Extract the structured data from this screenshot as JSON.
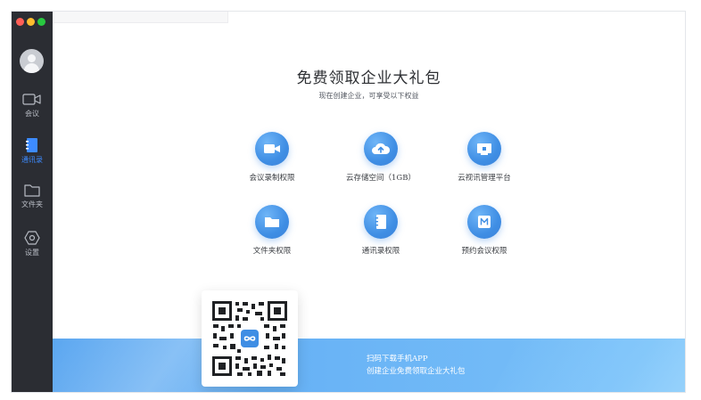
{
  "window": {
    "controls": [
      "close",
      "minimize",
      "zoom"
    ]
  },
  "sidebar": {
    "avatar_icon": "user-avatar-icon",
    "items": [
      {
        "label": "会议",
        "icon": "video-camera-icon",
        "active": false
      },
      {
        "label": "通讯录",
        "icon": "contacts-book-icon",
        "active": true
      },
      {
        "label": "文件夹",
        "icon": "folder-icon",
        "active": false
      },
      {
        "label": "设置",
        "icon": "settings-hexagon-icon",
        "active": false
      }
    ]
  },
  "main": {
    "title": "免费领取企业大礼包",
    "subtitle": "现在创建企业，可享受以下权益",
    "features": [
      {
        "label": "会议录制权限",
        "icon": "video-record-icon"
      },
      {
        "label": "云存储空间（1GB）",
        "icon": "cloud-upload-icon"
      },
      {
        "label": "云视讯管理平台",
        "icon": "monitor-icon"
      },
      {
        "label": "文件夹权限",
        "icon": "folder-icon"
      },
      {
        "label": "通讯录权限",
        "icon": "contacts-book-icon"
      },
      {
        "label": "预约会议权限",
        "icon": "calendar-m-icon"
      }
    ]
  },
  "banner": {
    "line1": "扫码下载手机APP",
    "line2": "创建企业免费领取企业大礼包",
    "qr_icon": "qr-code-icon"
  },
  "colors": {
    "sidebar_bg": "#2b2d33",
    "accent": "#3d8bff",
    "icon_blue": "#3f8ee4",
    "banner_blue": "#5aa6f0"
  }
}
